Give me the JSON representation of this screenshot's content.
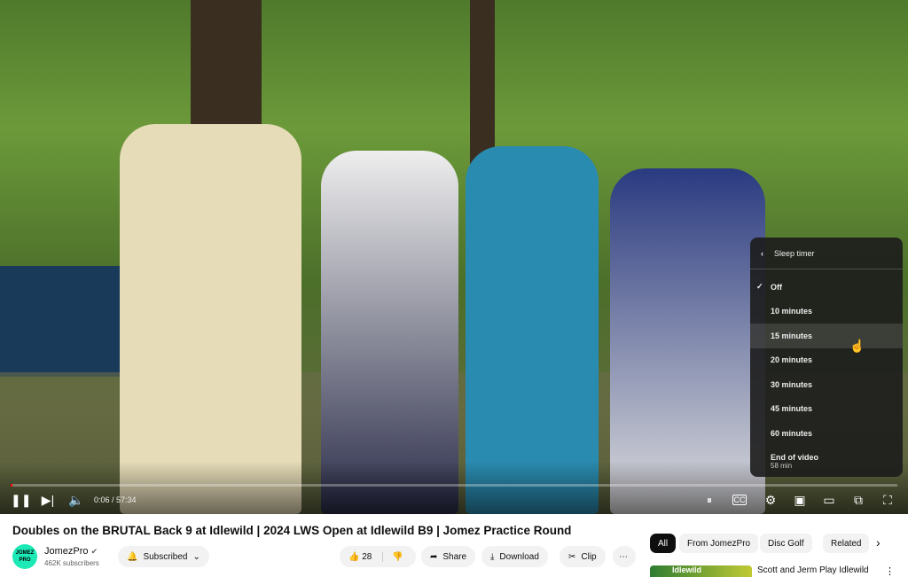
{
  "player": {
    "time": "0:06 / 57:34",
    "progress_percent": 0.17,
    "sleep_menu": {
      "title": "Sleep timer",
      "selected": "Off",
      "hovered": "15 minutes",
      "options": [
        "Off",
        "10 minutes",
        "15 minutes",
        "20 minutes",
        "30 minutes",
        "45 minutes",
        "60 minutes"
      ],
      "end_of_video": {
        "label": "End of video",
        "sub": "58 min"
      }
    }
  },
  "video": {
    "title": "Doubles on the BRUTAL Back 9 at Idlewild | 2024 LWS Open at Idlewild B9 | Jomez Practice Round",
    "channel": "JomezPro",
    "avatar_text": "JOMEZ PRO",
    "subscribers": "462K subscribers",
    "subscribed_label": "Subscribed",
    "likes": "28",
    "share": "Share",
    "download": "Download",
    "clip": "Clip"
  },
  "chips": [
    "All",
    "From JomezPro",
    "Disc Golf",
    "Related"
  ],
  "related": [
    {
      "title": "Scott and Jerm Play Idlewild",
      "thumb_text": "Idlewild"
    }
  ],
  "colors": {
    "accent": "#ff0000",
    "avatar": "#1de9b6"
  }
}
